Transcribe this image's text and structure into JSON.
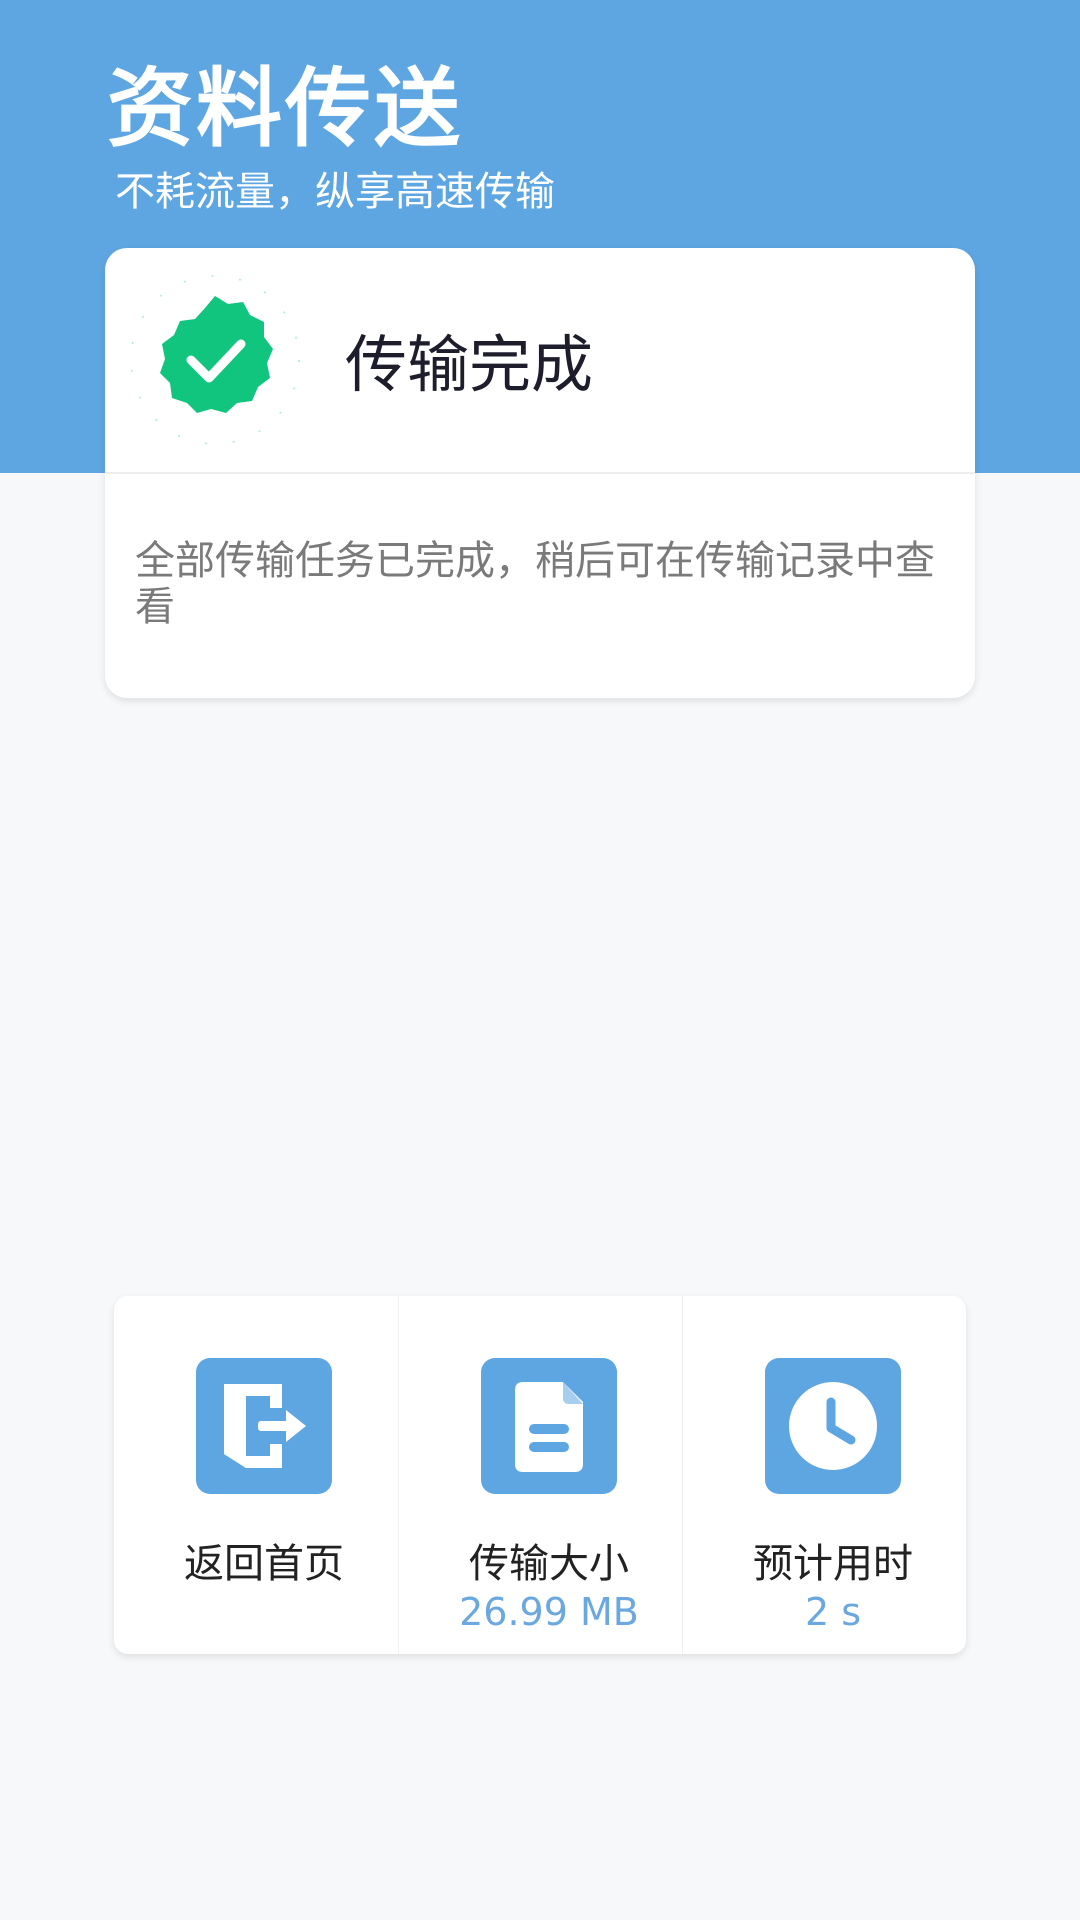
{
  "header": {
    "title": "资料传送",
    "subtitle": "不耗流量，纵享高速传输"
  },
  "status_card": {
    "title": "传输完成",
    "description": "全部传输任务已完成，稍后可在传输记录中查看",
    "badge_icon": "check-badge-icon",
    "badge_color": "#11c57f"
  },
  "actions": [
    {
      "label": "返回首页",
      "icon": "exit-door-icon"
    },
    {
      "label": "传输大小",
      "value": "26.99 MB",
      "icon": "document-icon"
    },
    {
      "label": "预计用时",
      "value": "2 s",
      "icon": "clock-icon"
    }
  ],
  "colors": {
    "header_blue": "#5ea6e2",
    "background": "#f7f8fa",
    "value_text": "#6aa8df"
  }
}
